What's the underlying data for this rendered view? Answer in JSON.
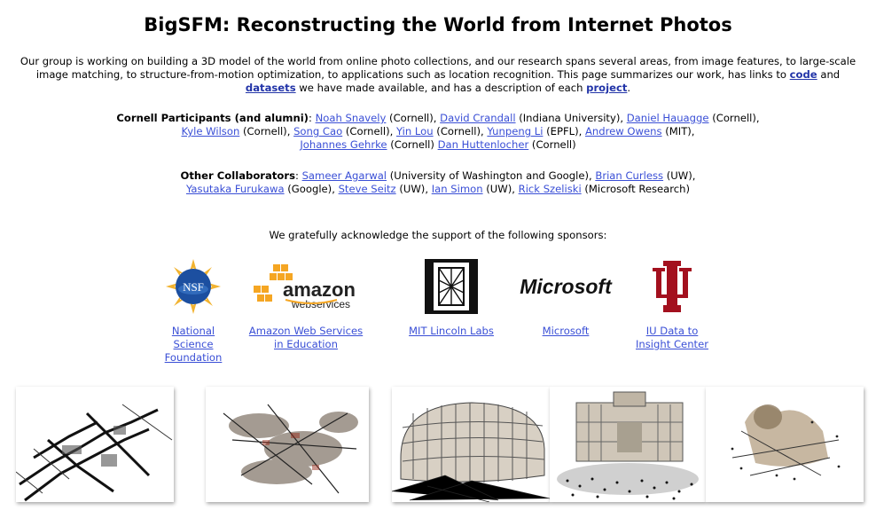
{
  "title": "BigSFM: Reconstructing the World from Internet Photos",
  "intro": {
    "t1": "Our group is working on building a 3D model of the world from online photo collections, and our research spans several areas, from image features, to large-scale image matching, to structure-from-motion optimization, to applications such as location recognition. This page summarizes our work, has links to ",
    "link_code": "code",
    "t2": " and ",
    "link_datasets": "datasets",
    "t3": " we have made available, and has a description of each ",
    "link_project": "project",
    "t4": "."
  },
  "cornell": {
    "label": "Cornell Participants (and alumni)",
    "colon": ": ",
    "people": [
      {
        "name": "Noah Snavely",
        "aff": " (Cornell), "
      },
      {
        "name": "David Crandall",
        "aff": " (Indiana University), "
      },
      {
        "name": "Daniel Hauagge",
        "aff": " (Cornell),"
      },
      {
        "name": "Kyle Wilson",
        "aff": " (Cornell), "
      },
      {
        "name": "Song Cao",
        "aff": " (Cornell), "
      },
      {
        "name": "Yin Lou",
        "aff": " (Cornell), "
      },
      {
        "name": "Yunpeng Li",
        "aff": " (EPFL), "
      },
      {
        "name": "Andrew Owens",
        "aff": " (MIT),"
      },
      {
        "name": "Johannes Gehrke",
        "aff": " (Cornell) "
      },
      {
        "name": "Dan Huttenlocher",
        "aff": " (Cornell)"
      }
    ]
  },
  "collab": {
    "label": "Other Collaborators",
    "colon": ": ",
    "people": [
      {
        "name": "Sameer Agarwal",
        "aff": " (University of Washington and Google), "
      },
      {
        "name": "Brian Curless",
        "aff": " (UW),"
      },
      {
        "name": "Yasutaka Furukawa",
        "aff": " (Google), "
      },
      {
        "name": "Steve Seitz",
        "aff": " (UW), "
      },
      {
        "name": "Ian Simon",
        "aff": " (UW), "
      },
      {
        "name": "Rick Szeliski",
        "aff": " (Microsoft Research)"
      }
    ]
  },
  "ack": "We gratefully acknowledge the support of the following sponsors:",
  "sponsors": [
    {
      "l1": "National Science",
      "l2": "Foundation",
      "logo_text": "NSF",
      "icon": "nsf-logo"
    },
    {
      "l1": "Amazon Web Services",
      "l2": "in Education",
      "logo_text": "amazon",
      "logo_sub": "webservices",
      "icon": "aws-logo"
    },
    {
      "l1": "MIT Lincoln Labs",
      "l2": "",
      "icon": "mit-ll-logo"
    },
    {
      "l1": "Microsoft",
      "l2": "",
      "logo_text": "Microsoft",
      "icon": "microsoft-logo"
    },
    {
      "l1": "IU Data to",
      "l2": "Insight Center",
      "icon": "iu-logo"
    }
  ],
  "colors": {
    "link": "#3a4fd6",
    "iu_red": "#a3101e",
    "aws_orange": "#f5a623",
    "nsf_blue": "#1c4fa0"
  }
}
